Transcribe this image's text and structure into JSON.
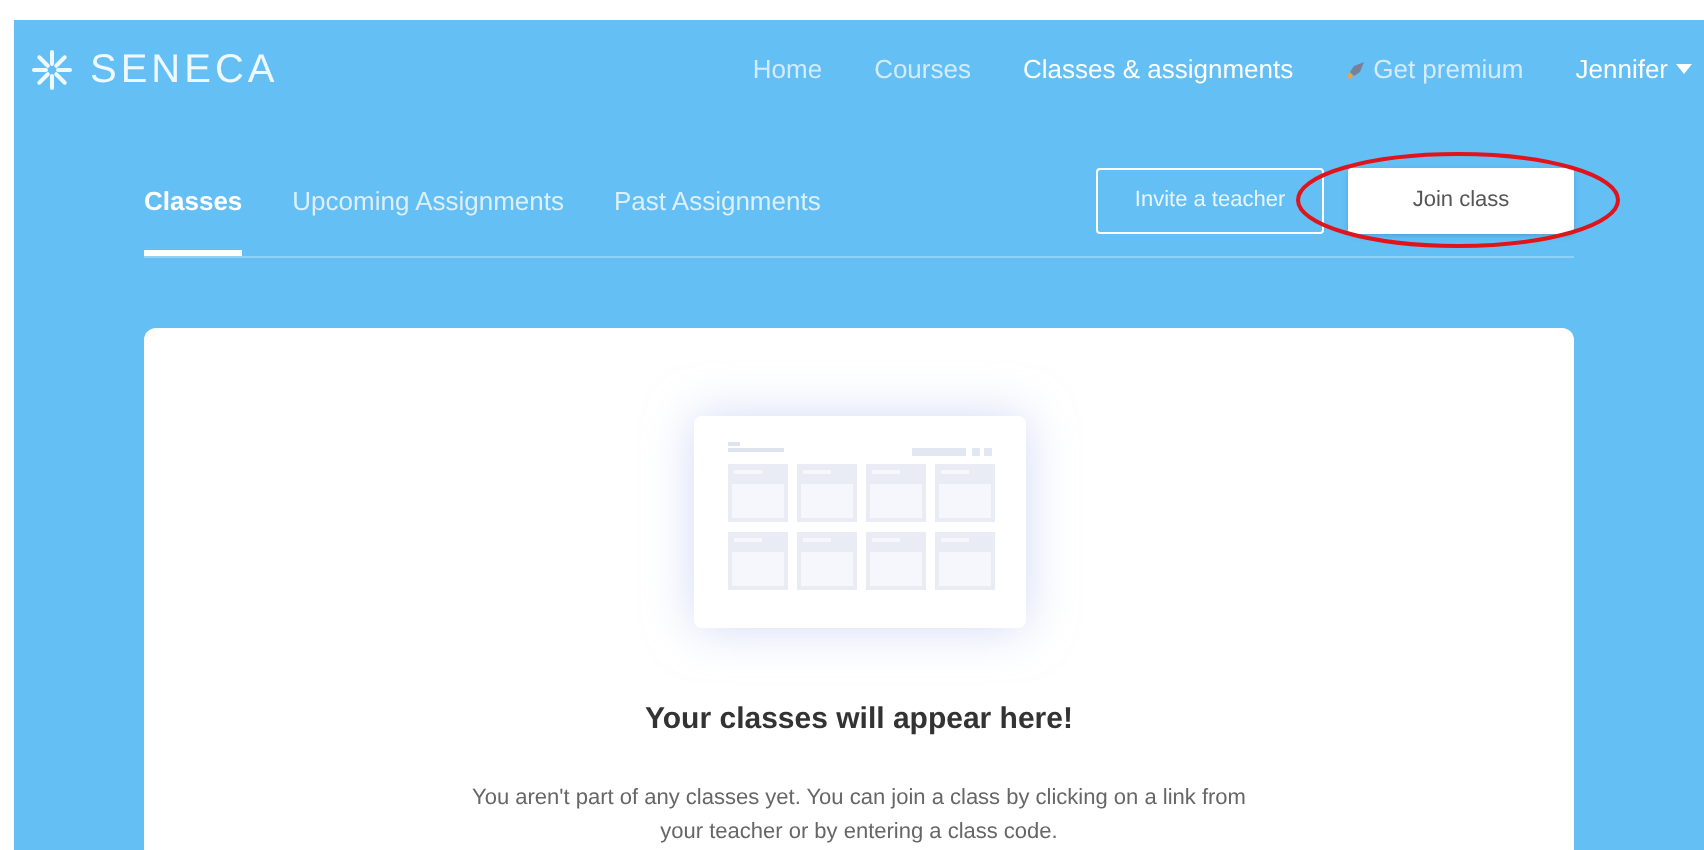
{
  "logo": {
    "text": "SENECA"
  },
  "nav": [
    {
      "label": "Home",
      "selected": false
    },
    {
      "label": "Courses",
      "selected": false
    },
    {
      "label": "Classes & assignments",
      "selected": true
    },
    {
      "label": "Get premium",
      "selected": false,
      "kind": "premium"
    }
  ],
  "user": {
    "name": "Jennifer"
  },
  "tabs": [
    {
      "label": "Classes",
      "selected": true
    },
    {
      "label": "Upcoming Assignments",
      "selected": false
    },
    {
      "label": "Past Assignments",
      "selected": false
    }
  ],
  "buttons": [
    {
      "label": "Invite a teacher",
      "kind": "outline"
    },
    {
      "label": "Join class",
      "kind": "solid",
      "highlighted": true
    }
  ],
  "empty_state": {
    "title": "Your classes will appear here!",
    "message": "You aren't part of any classes yet. You can join a class by clicking on a link from your teacher or by entering a class code."
  }
}
